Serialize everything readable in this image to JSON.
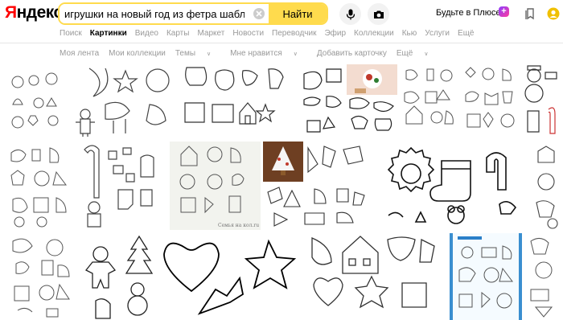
{
  "header": {
    "logo_first": "Я",
    "logo_rest": "ндекс",
    "search_value": "игрушки на новый год из фетра шаблоны",
    "find_label": "Найти",
    "plus_label": "Будьте в Плюсе",
    "plus_badge": "+"
  },
  "services": [
    "Поиск",
    "Картинки",
    "Видео",
    "Карты",
    "Маркет",
    "Новости",
    "Переводчик",
    "Эфир",
    "Коллекции",
    "Кью",
    "Услуги",
    "Ещё"
  ],
  "active_service": "Картинки",
  "subnav": [
    "Моя лента",
    "Мои коллекции",
    "Темы",
    "Мне нравится",
    "Добавить карточку",
    "Ещё"
  ],
  "image_captions": {
    "watermark": "Семья на кол.ru"
  }
}
